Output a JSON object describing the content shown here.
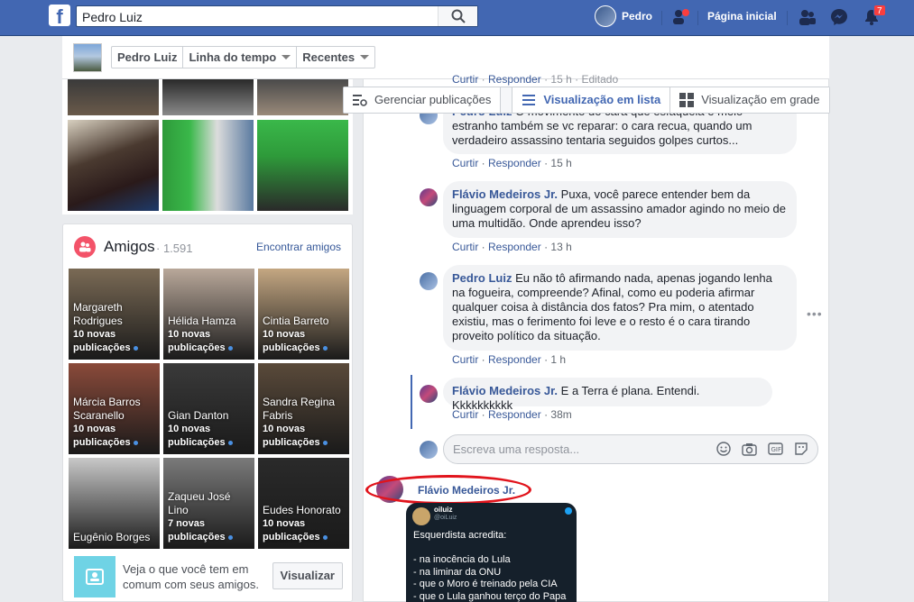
{
  "topbar": {
    "search_value": "Pedro Luiz",
    "user_name": "Pedro",
    "home_link": "Página inicial",
    "notification_count": "7"
  },
  "timeline_header": {
    "tabs": [
      {
        "label": "Pedro Luiz"
      },
      {
        "label": "Linha do tempo"
      },
      {
        "label": "Recentes"
      }
    ]
  },
  "view_switch": {
    "manage": "Gerenciar publicações",
    "list": "Visualização em lista",
    "grid": "Visualização em grade"
  },
  "friends": {
    "title": "Amigos",
    "count": "· 1.591",
    "find": "Encontrar amigos",
    "items": [
      {
        "name": "Margareth Rodrigues",
        "sub": "10 novas publicações",
        "color": "#7a6a55"
      },
      {
        "name": "Hélida Hamza",
        "sub": "10 novas publicações",
        "color": "#b9a89a"
      },
      {
        "name": "Cintia Barreto",
        "sub": "10 novas publicações",
        "color": "#c4a782"
      },
      {
        "name": "Márcia Barros Scaranello",
        "sub": "10 novas publicações",
        "color": "#8a4a3a"
      },
      {
        "name": "Gian Danton",
        "sub": "10 novas publicações",
        "color": "#3a3a3a"
      },
      {
        "name": "Sandra Regina Fabris",
        "sub": "10 novas publicações",
        "color": "#5a4a3a"
      },
      {
        "name": "Eugênio Borges",
        "sub": "",
        "color": "#c8c8c8"
      },
      {
        "name": "Zaqueu José Lino",
        "sub": "7 novas publicações",
        "color": "#7a7a7a"
      },
      {
        "name": "Eudes Honorato",
        "sub": "10 novas publicações",
        "color": "#2a2a2a"
      }
    ],
    "common_text": "Veja o que você tem em comum com seus amigos.",
    "common_button": "Visualizar"
  },
  "comments": [
    {
      "author": "Pedro Luiz",
      "text": "O movimento do cara que esfaqueia é meio estranho também se vc reparar: o cara recua, quando um verdadeiro assassino tentaria seguidos golpes curtos...",
      "like": "Curtir",
      "reply": "Responder",
      "time": "15 h"
    },
    {
      "author": "Flávio Medeiros Jr.",
      "text": "Puxa, você parece entender bem da linguagem corporal de um assassino amador agindo no meio de uma multidão. Onde aprendeu isso?",
      "like": "Curtir",
      "reply": "Responder",
      "time": "13 h"
    },
    {
      "author": "Pedro Luiz",
      "text": "Eu não tô afirmando nada, apenas jogando lenha na fogueira, compreende? Afinal, como eu poderia afirmar qualquer coisa à distância dos fatos? Pra mim, o atentado existiu, mas o ferimento foi leve e o resto é o cara tirando proveito político da situação.",
      "like": "Curtir",
      "reply": "Responder",
      "time": "1 h"
    },
    {
      "author": "Flávio Medeiros Jr.",
      "text": "E a Terra é plana. Entendi. Kkkkkkkkkk",
      "like": "Curtir",
      "reply": "Responder",
      "time": "38m"
    }
  ],
  "top_actions": {
    "like": "Curtir",
    "reply": "Responder",
    "time": "15 h",
    "edited": "Editado"
  },
  "reply_placeholder": "Escreva uma resposta...",
  "shared": {
    "author": "Flávio Medeiros Jr.",
    "tweet_user": "oiluiz",
    "tweet_handle": "@oiLuiz",
    "tweet_text": "Esquerdista acredita:\n\n- na inocência do Lula\n- na liminar da ONU\n- que o Moro é treinado pela CIA\n- que o Lula ganhou terço do Papa"
  },
  "colors": {
    "brand": "#4267b2",
    "link": "#385898",
    "highlight": "#e1141c"
  }
}
